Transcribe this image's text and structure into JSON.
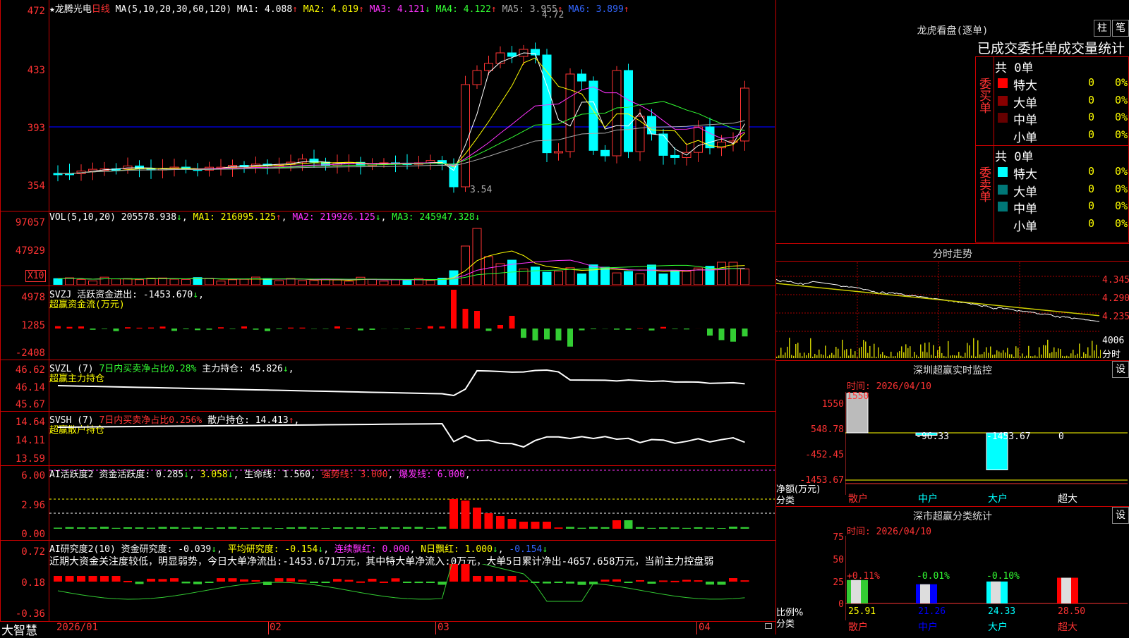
{
  "main": {
    "stock_label": "★龙腾光电",
    "period": "日线",
    "ma_params": "MA(5,10,20,30,60,120)",
    "ma": [
      {
        "label": "MA1: 4.088",
        "arrow": "↑",
        "color": "#ffffff"
      },
      {
        "label": "MA2: 4.019",
        "arrow": "↑",
        "color": "#ffff00"
      },
      {
        "label": "MA3: 4.121",
        "arrow": "↓",
        "color": "#ff33ff"
      },
      {
        "label": "MA4: 4.122",
        "arrow": "↑",
        "color": "#33ff33"
      },
      {
        "label": "MA5: 3.955",
        "arrow": "↑",
        "color": "#aaaaaa"
      },
      {
        "label": "MA6: 3.899",
        "arrow": "↑",
        "color": "#3366ff"
      }
    ],
    "axis": [
      "472",
      "433",
      "393",
      "354"
    ],
    "high_marker": "4.72",
    "low_marker": "3.54"
  },
  "vol": {
    "header": "VOL(5,10,20)",
    "value": "205578.938",
    "ma1": "MA1: 216095.125",
    "ma2": "MA2: 219926.125",
    "ma3": "MA3: 245947.328",
    "axis": [
      "97057",
      "47929"
    ],
    "unit": "X10"
  },
  "svzj": {
    "name": "SVZJ",
    "desc": "活跃资金进出: -1453.670",
    "sub": "超赢资金流(万元)",
    "axis": [
      "4978",
      "1285",
      "-2408"
    ]
  },
  "svzl": {
    "name": "SVZL (7)",
    "desc": "7日内买卖净占比0.28%",
    "pos": "主力持仓: 45.826",
    "sub": "超赢主力持仓",
    "axis": [
      "46.62",
      "46.14",
      "45.67"
    ]
  },
  "svsh": {
    "name": "SVSH (7)",
    "desc": "7日内买卖净占比0.256%",
    "pos": "散户持仓: 14.413",
    "sub": "超赢散户持仓",
    "axis": [
      "14.64",
      "14.11",
      "13.59"
    ]
  },
  "ai2": {
    "name": "AI活跃度2",
    "a": "资金活跃度: 0.285",
    "b": "3.058",
    "c": "生命线: 1.560",
    "d": "强势线: 3.000",
    "e": "爆发线: 6.000",
    "axis": [
      "6.00",
      "2.96",
      "0.00"
    ]
  },
  "ai10": {
    "name": "AI研究度2(10)",
    "a": "资金研究度: -0.039",
    "b": "平均研究度: -0.154",
    "c": "连续飘红: 0.000",
    "d": "N日飘红: 1.000",
    "e": "-0.154",
    "comment": "近期大资金关注度较低，明显弱势，今日大单净流出:-1453.671万元，其中特大单净流入:0万元，大单5日累计净出-4657.658万元，当前主力控盘弱",
    "axis": [
      "0.72",
      "0.18",
      "-0.36"
    ]
  },
  "dates": [
    "2026/01",
    "02",
    "03",
    "04"
  ],
  "brand": "大智慧",
  "right": {
    "lhb_title": "龙虎看盘(逐单)",
    "btn_zhu": "柱",
    "btn_bi": "笔",
    "stat_title": "已成交委托单成交量统计",
    "buy_label": "委买单",
    "sell_label": "委卖单",
    "buy_total": "共 0单",
    "sell_total": "共 0单",
    "rows": [
      "特大",
      "大单",
      "中单",
      "小单"
    ],
    "row_vals": [
      "0",
      "0%"
    ],
    "fenshi_title": "分时走势",
    "fenshi_axis": [
      "4.345",
      "4.290",
      "4.235",
      "4006",
      "分时"
    ],
    "monitor_title": "深圳超赢实时监控",
    "set": "设",
    "time_label": "时间: 2026/04/10",
    "monitor_axis": [
      "1550",
      "548.78",
      "-452.45",
      "-1453.67"
    ],
    "monitor_vals": [
      "1550",
      "-96.33",
      "-1453.67",
      "0"
    ],
    "monitor_unit": [
      "净额(万元)",
      "分类"
    ],
    "cats": [
      "散户",
      "中户",
      "大户",
      "超大"
    ],
    "class_title": "深市超赢分类统计",
    "class_axis": [
      "75",
      "50",
      "25",
      "0"
    ],
    "class_pct": [
      "+0.11%",
      "-0.01%",
      "-0.10%"
    ],
    "class_vals": [
      "25.91",
      "21.26",
      "24.33",
      "28.50"
    ],
    "class_unit": [
      "比例%",
      "分类"
    ]
  }
}
